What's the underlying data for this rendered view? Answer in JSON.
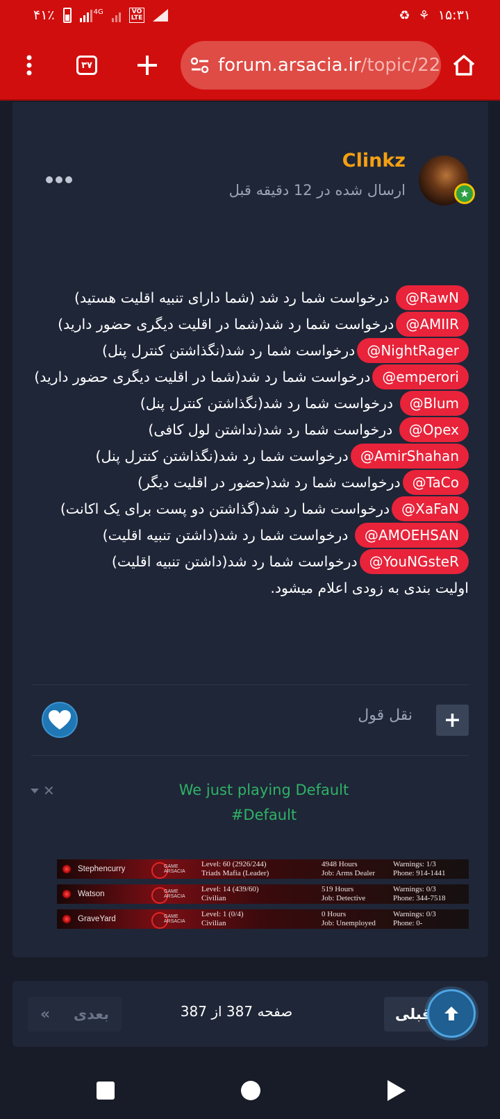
{
  "status_bar": {
    "battery": "۴۱٪",
    "network": "4G",
    "lte_label": "VO\nLTE",
    "time": "۱۵:۳۱"
  },
  "browser": {
    "tab_count": "۳۷",
    "url_host": "forum.arsacia.ir",
    "url_path": "/topic/22"
  },
  "post": {
    "author": "Clinkz",
    "author_color": "#f5a011",
    "posted": "ارسال شده در 12 دقیقه قبل",
    "lines": [
      {
        "mention": "@RawN",
        "text": " درخواست شما رد شد (شما دارای تنبیه اقلیت هستید)"
      },
      {
        "mention": "@AMIIR",
        "text": "درخواست شما رد شد(شما در اقلیت دیگری حضور دارید)"
      },
      {
        "mention": "@NightRager",
        "text": "درخواست شما رد شد(نگذاشتن کنترل پنل)"
      },
      {
        "mention": "@emperori",
        "text": "درخواست شما رد شد(شما در اقلیت دیگری حضور دارید)"
      },
      {
        "mention": "@Blum",
        "text": " درخواست شما رد شد(نگذاشتن کنترل پنل)"
      },
      {
        "mention": "@Opex",
        "text": " درخواست شما رد شد(نداشتن لول کافی)"
      },
      {
        "mention": "@AmirShahan",
        "text": "درخواست شما رد شد(نگذاشتن کنترل پنل)"
      },
      {
        "mention": "@TaCo",
        "text": "درخواست شما رد شد(حضور در اقلیت دیگر)"
      },
      {
        "mention": "@XaFaN",
        "text": "درخواست شما رد شد(گذاشتن دو پست برای یک اکانت)"
      },
      {
        "mention": "@AMOEHSAN",
        "text": " درخواست شما رد شد(داشتن تنبیه اقلیت)"
      },
      {
        "mention": "@YouNGsteR",
        "text": "درخواست شما رد شد(داشتن تنبیه اقلیت)"
      }
    ],
    "footer": "اولیت بندی به زودی اعلام میشود.",
    "quote_label": "نقل قول",
    "plus_label": "+"
  },
  "signature": {
    "line1": "We just playing Default",
    "line2": "#Default",
    "logo_text": "GAME\nARSACIA",
    "rows": [
      {
        "name": "Stephencurry",
        "level": "Level: 60 (2926/244)",
        "faction": "Triads Mafia (Leader)",
        "hours": "4948 Hours",
        "job": "Job: Arms Dealer",
        "warnings": "Warnings: 1/3",
        "phone": "Phone: 914-1441"
      },
      {
        "name": "Watson",
        "level": "Level: 14 (439/60)",
        "faction": "Civilian",
        "hours": "519 Hours",
        "job": "Job: Detective",
        "warnings": "Warnings: 0/3",
        "phone": "Phone: 344-7518"
      },
      {
        "name": "GraveYard",
        "level": "Level: 1 (0/4)",
        "faction": "Civilian",
        "hours": "0 Hours",
        "job": "Job: Unemployed",
        "warnings": "Warnings: 0/3",
        "phone": "Phone: 0-"
      }
    ]
  },
  "pagination": {
    "next_label": "بعدی",
    "next_chevron": "«",
    "page_info": "صفحه 387 از 387",
    "prev_label": "قبلی"
  },
  "colors": {
    "brand_red": "#d10e0e",
    "mention_red": "#e8233a",
    "signature_green": "#2fb365",
    "like_blue": "#1f77b4"
  }
}
